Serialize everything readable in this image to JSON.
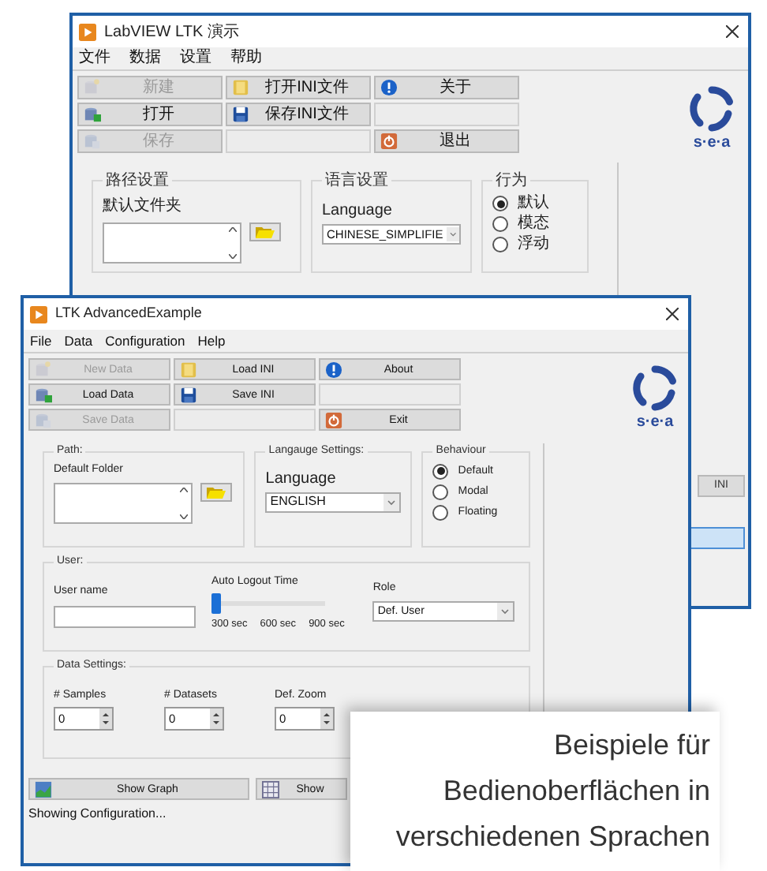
{
  "back_window": {
    "title": "LabVIEW LTK 演示",
    "menu": [
      "文件",
      "数据",
      "设置",
      "帮助"
    ],
    "toolbar": [
      {
        "kind": "new",
        "label": "新建",
        "disabled": true
      },
      {
        "kind": "open-ini",
        "label": "打开INI文件",
        "disabled": false
      },
      {
        "kind": "about",
        "label": "关于",
        "disabled": false
      },
      {
        "kind": "load",
        "label": "打开",
        "disabled": false
      },
      {
        "kind": "save-ini",
        "label": "保存INI文件",
        "disabled": false
      },
      {
        "kind": "empty"
      },
      {
        "kind": "save",
        "label": "保存",
        "disabled": true
      },
      {
        "kind": "empty"
      },
      {
        "kind": "exit",
        "label": "退出",
        "disabled": false
      }
    ],
    "logo": "s·e·a",
    "path_group": {
      "title": "路径设置",
      "label": "默认文件夹"
    },
    "language_group": {
      "title": "语言设置",
      "label": "Language",
      "value": "CHINESE_SIMPLIFIE"
    },
    "behaviour_group": {
      "title": "行为",
      "options": [
        {
          "label": "默认",
          "selected": true
        },
        {
          "label": "模态",
          "selected": false
        },
        {
          "label": "浮动",
          "selected": false
        }
      ]
    },
    "side_button": "INI"
  },
  "front_window": {
    "title": "LTK AdvancedExample",
    "menu": [
      "File",
      "Data",
      "Configuration",
      "Help"
    ],
    "toolbar": [
      {
        "kind": "new",
        "label": "New Data",
        "disabled": true
      },
      {
        "kind": "open-ini",
        "label": "Load INI",
        "disabled": false
      },
      {
        "kind": "about",
        "label": "About",
        "disabled": false
      },
      {
        "kind": "load",
        "label": "Load Data",
        "disabled": false
      },
      {
        "kind": "save-ini",
        "label": "Save INI",
        "disabled": false
      },
      {
        "kind": "empty"
      },
      {
        "kind": "save",
        "label": "Save Data",
        "disabled": true
      },
      {
        "kind": "empty"
      },
      {
        "kind": "exit",
        "label": "Exit",
        "disabled": false
      }
    ],
    "logo": "s·e·a",
    "path_group": {
      "title": "Path:",
      "label": "Default Folder"
    },
    "language_group": {
      "title": "Langauge Settings:",
      "label": "Language",
      "value": "ENGLISH"
    },
    "behaviour_group": {
      "title": "Behaviour",
      "options": [
        {
          "label": "Default",
          "selected": true
        },
        {
          "label": "Modal",
          "selected": false
        },
        {
          "label": "Floating",
          "selected": false
        }
      ]
    },
    "user_group": {
      "title": "User:",
      "name_label": "User name",
      "slider": {
        "label": "Auto Logout Time",
        "level": 0,
        "ticks": [
          "300 sec",
          "600 sec",
          "900 sec"
        ]
      },
      "role": {
        "label": "Role",
        "value": "Def. User"
      }
    },
    "data_group": {
      "title": "Data Settings:",
      "fields": [
        {
          "label": "# Samples",
          "value": "0"
        },
        {
          "label": "# Datasets",
          "value": "0"
        },
        {
          "label": "Def. Zoom",
          "value": "0"
        }
      ]
    },
    "bottom_buttons": [
      {
        "kind": "graph",
        "label": "Show Graph"
      },
      {
        "kind": "table",
        "label": "Show"
      }
    ],
    "status": "Showing Configuration..."
  },
  "caption": [
    "Beispiele für",
    "Bedienoberflächen in",
    "verschiedenen Sprachen"
  ]
}
